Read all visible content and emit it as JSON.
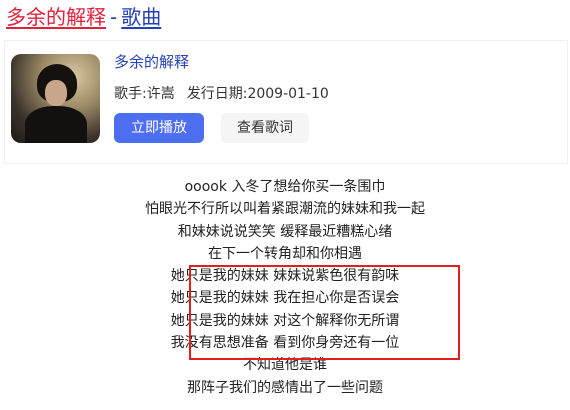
{
  "header": {
    "song_link": "多余的解释",
    "separator": "-",
    "type_link": "歌曲"
  },
  "song_card": {
    "cover_icon": "album-cover-image",
    "song_name": "多余的解释",
    "singer_label": "歌手:",
    "singer_name": "许嵩",
    "release_label": "发行日期:",
    "release_date": "2009-01-10",
    "play_button": "立即播放",
    "lyrics_button": "查看歌词"
  },
  "lyrics": [
    "ooook 入冬了想给你买一条围巾",
    "怕眼光不行所以叫着紧跟潮流的妹妹和我一起",
    "和妹妹说说笑笑 缓释最近糟糕心绪",
    "在下一个转角却和你相遇",
    "她只是我的妹妹 妹妹说紫色很有韵味",
    "她只是我的妹妹 我在担心你是否误会",
    "她只是我的妹妹 对这个解释你无所谓",
    "我没有思想准备 看到你身旁还有一位",
    "不知道他是谁",
    "那阵子我们的感情出了一些问题"
  ],
  "colors": {
    "song_link": "#e0213b",
    "link_blue": "#2440b3",
    "play_button": "#4e6ef2",
    "highlight_border": "#e02020"
  }
}
